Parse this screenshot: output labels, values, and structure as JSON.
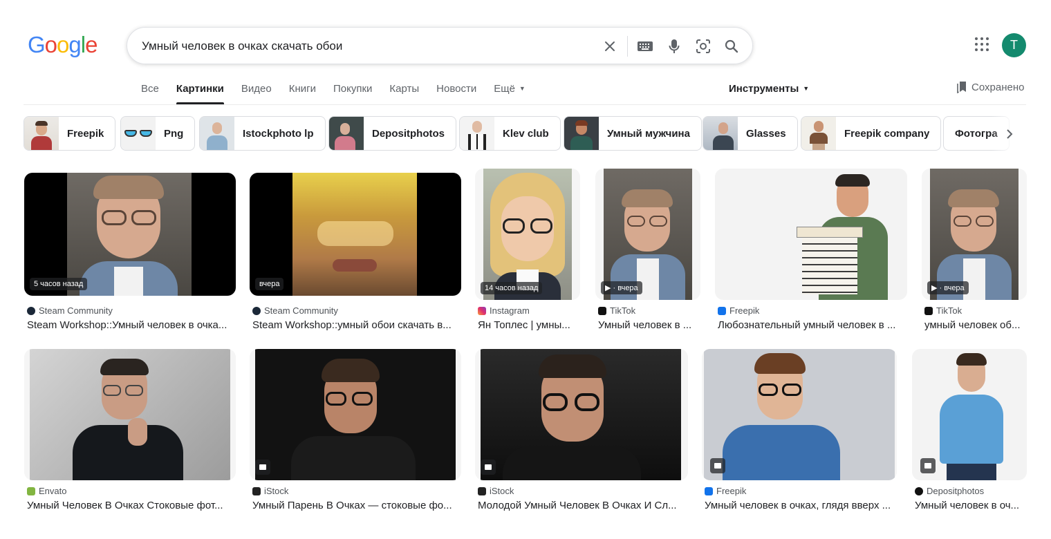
{
  "logo": {
    "letters": [
      "G",
      "o",
      "o",
      "g",
      "l",
      "e"
    ],
    "colors": [
      "#4285f4",
      "#ea4335",
      "#fbbc05",
      "#4285f4",
      "#34a853",
      "#ea4335"
    ]
  },
  "search": {
    "query": "Умный человек в очках скачать обои"
  },
  "account": {
    "initial": "T"
  },
  "tabs": [
    {
      "label": "Все"
    },
    {
      "label": "Картинки",
      "active": true
    },
    {
      "label": "Видео"
    },
    {
      "label": "Книги"
    },
    {
      "label": "Покупки"
    },
    {
      "label": "Карты"
    },
    {
      "label": "Новости"
    },
    {
      "label": "Ещё"
    }
  ],
  "tools_label": "Инструменты",
  "saved_label": "Сохранено",
  "chips": [
    {
      "label": "Freepik"
    },
    {
      "label": "Png"
    },
    {
      "label": "Istockphoto lp"
    },
    {
      "label": "Depositphotos"
    },
    {
      "label": "Klev club"
    },
    {
      "label": "Умный мужчина"
    },
    {
      "label": "Glasses"
    },
    {
      "label": "Freepik company"
    },
    {
      "label": "Фотогра"
    }
  ],
  "results": [
    {
      "badge": "5 часов назад",
      "source": "Steam Community",
      "title": "Steam Workshop::Умный человек в очка..."
    },
    {
      "badge": "вчера",
      "source": "Steam Community",
      "title": "Steam Workshop::умный обои скачать в..."
    },
    {
      "badge": "14 часов назад",
      "source": "Instagram",
      "title": "Ян Топлес | умны..."
    },
    {
      "badge": "· вчера",
      "source": "TikTok",
      "title": "Умный человек в ..."
    },
    {
      "badge": "",
      "source": "Freepik",
      "title": "Любознательный умный человек в ..."
    },
    {
      "badge": "· вчера",
      "source": "TikTok",
      "title": "умный человек об..."
    },
    {
      "badge": "",
      "source": "Envato",
      "title": "Умный Человек В Очках Стоковые фот..."
    },
    {
      "badge": "",
      "source": "iStock",
      "title": "Умный Парень В Очках — стоковые фо..."
    },
    {
      "badge": "",
      "source": "iStock",
      "title": "Молодой Умный Человек В Очках И Сл..."
    },
    {
      "badge": "",
      "source": "Freepik",
      "title": "Умный человек в очках, глядя вверх ..."
    },
    {
      "badge": "",
      "source": "Depositphotos",
      "title": "Умный человек в оч..."
    }
  ],
  "colors": {
    "avatar": "#148a6e",
    "active_tab_underline": "#202124",
    "text": "#202124",
    "muted": "#5f6368"
  }
}
